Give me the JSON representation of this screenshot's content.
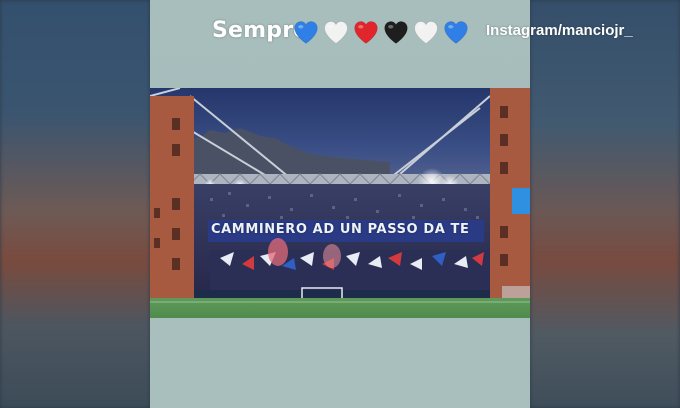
{
  "story": {
    "caption": "Sempre",
    "hearts": [
      {
        "color": "#2f7fe6",
        "name": "blue-heart-icon"
      },
      {
        "color": "#f2f2f2",
        "name": "white-heart-icon"
      },
      {
        "color": "#e0252c",
        "name": "red-heart-icon"
      },
      {
        "color": "#1e1e1e",
        "name": "black-heart-icon"
      },
      {
        "color": "#f2f2f2",
        "name": "white-heart-icon"
      },
      {
        "color": "#2f7fe6",
        "name": "blue-heart-icon"
      }
    ],
    "handle": "Instagram/manciojr_"
  },
  "photo": {
    "banner_text": "CAMMINERO AD UN PASSO DA TE"
  }
}
